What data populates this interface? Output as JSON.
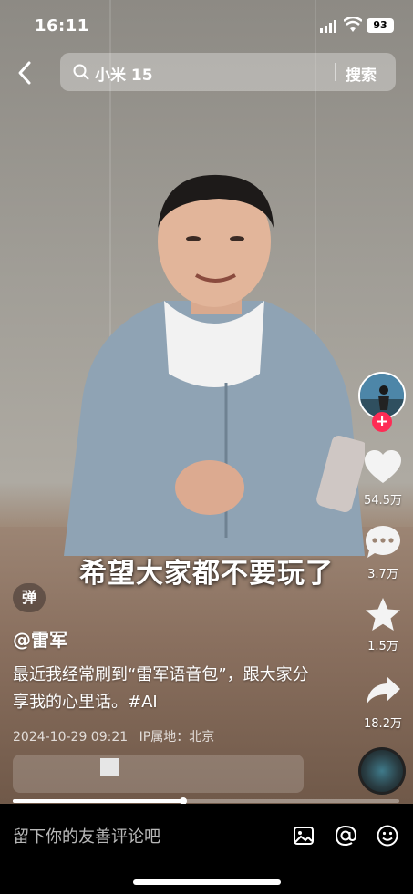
{
  "status_bar": {
    "time": "16:11",
    "battery": "93"
  },
  "search": {
    "query": "小米 15",
    "submit_label": "搜索"
  },
  "video": {
    "subtitle": "希望大家都不要玩了",
    "progress": 0.44
  },
  "danmu": {
    "label": "弹"
  },
  "right_rail": {
    "likes": "54.5万",
    "comments": "3.7万",
    "favorites": "1.5万",
    "shares": "18.2万"
  },
  "caption": {
    "author": "@雷军",
    "description": "最近我经常刷到“雷军语音包”，跟大家分享我的心里话。#AI",
    "date": "2024-10-29 09:21",
    "ip_location": "IP属地：北京"
  },
  "comment_bar": {
    "placeholder": "留下你的友善评论吧"
  },
  "colors": {
    "follow_accent": "#fe2c55",
    "bar_bg": "#000000"
  },
  "icons": [
    "back-arrow-icon",
    "search-icon",
    "heart-icon",
    "comment-icon",
    "star-icon",
    "share-icon",
    "image-icon",
    "at-icon",
    "emoji-icon"
  ]
}
